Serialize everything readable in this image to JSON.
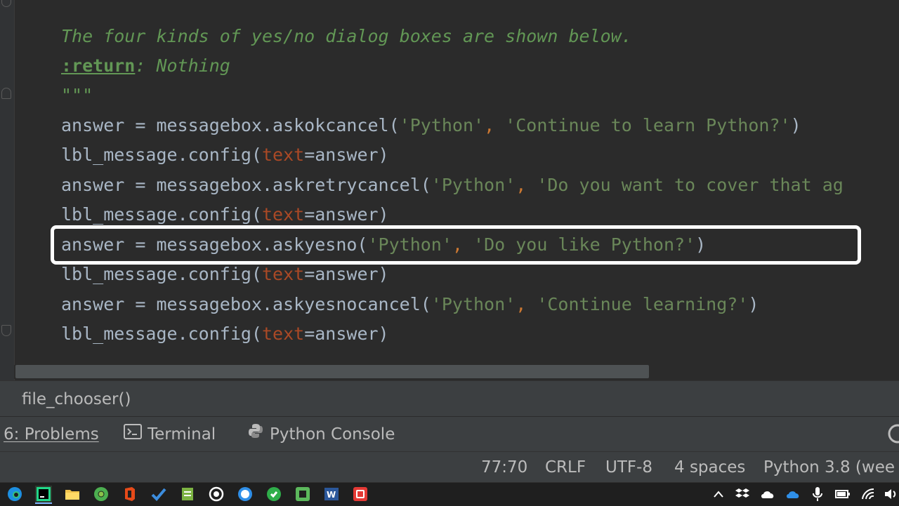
{
  "editor": {
    "lines": [
      {
        "tokens": [
          {
            "t": "\"\"\"",
            "c": "doc"
          }
        ]
      },
      {
        "tokens": [
          {
            "t": "The four kinds of yes/no dialog boxes are shown below.",
            "c": "doc"
          }
        ]
      },
      {
        "tokens": [
          {
            "t": ":return",
            "c": "doctag"
          },
          {
            "t": ": Nothing",
            "c": "doc"
          }
        ]
      },
      {
        "tokens": [
          {
            "t": "\"\"\"",
            "c": "doc"
          }
        ]
      },
      {
        "tokens": [
          {
            "t": "answer = messagebox.askokcancel(",
            "c": ""
          },
          {
            "t": "'Python'",
            "c": "str"
          },
          {
            "t": ", ",
            "c": "kw"
          },
          {
            "t": "'Continue to learn Python?'",
            "c": "str"
          },
          {
            "t": ")",
            "c": ""
          }
        ]
      },
      {
        "tokens": [
          {
            "t": "lbl_message.config(",
            "c": ""
          },
          {
            "t": "text",
            "c": "param"
          },
          {
            "t": "=answer)",
            "c": ""
          }
        ]
      },
      {
        "tokens": [
          {
            "t": "answer = messagebox.askretrycancel(",
            "c": ""
          },
          {
            "t": "'Python'",
            "c": "str"
          },
          {
            "t": ", ",
            "c": "kw"
          },
          {
            "t": "'Do you want to cover that ag",
            "c": "str"
          }
        ]
      },
      {
        "tokens": [
          {
            "t": "lbl_message.config(",
            "c": ""
          },
          {
            "t": "text",
            "c": "param"
          },
          {
            "t": "=answer)",
            "c": ""
          }
        ]
      },
      {
        "tokens": [
          {
            "t": "answer = messagebox.askyesno(",
            "c": ""
          },
          {
            "t": "'Python'",
            "c": "str"
          },
          {
            "t": ", ",
            "c": "kw"
          },
          {
            "t": "'Do you like Python?'",
            "c": "str"
          },
          {
            "t": ")",
            "c": ""
          }
        ]
      },
      {
        "tokens": [
          {
            "t": "lbl_message.config(",
            "c": ""
          },
          {
            "t": "text",
            "c": "param"
          },
          {
            "t": "=answer)",
            "c": ""
          }
        ]
      },
      {
        "tokens": [
          {
            "t": "answer = messagebox.askyesnocancel(",
            "c": ""
          },
          {
            "t": "'Python'",
            "c": "str"
          },
          {
            "t": ", ",
            "c": "kw"
          },
          {
            "t": "'Continue learning?'",
            "c": "str"
          },
          {
            "t": ")",
            "c": ""
          }
        ]
      },
      {
        "tokens": [
          {
            "t": "lbl_message.config(",
            "c": ""
          },
          {
            "t": "text",
            "c": "param"
          },
          {
            "t": "=answer)",
            "c": ""
          }
        ]
      }
    ]
  },
  "breadcrumb": {
    "label": "file_chooser()"
  },
  "tool_tabs": {
    "problems": "6: Problems",
    "terminal": "Terminal",
    "python_console": "Python Console"
  },
  "status_bar": {
    "position": "77:70",
    "line_separator": "CRLF",
    "encoding": "UTF-8",
    "indent": "4 spaces",
    "interpreter": "Python 3.8 (wee"
  },
  "colors": {
    "editor_bg": "#2b2b2b",
    "docstring": "#629755",
    "string": "#6a8759",
    "keyword": "#cc7832",
    "param": "#aa4926",
    "default_text": "#a9b7c6",
    "highlight_border": "#ffffff"
  },
  "taskbar": {
    "apps": [
      "edge-icon",
      "pycharm-icon",
      "file-explorer-icon",
      "chrome-icon",
      "office-icon",
      "todo-icon",
      "notepad-icon",
      "whatsapp-icon",
      "signal-icon",
      "greenshot-icon",
      "camtasia-icon",
      "word-icon",
      "recorder-icon"
    ],
    "tray": [
      "chevron-up-icon",
      "dropbox-icon",
      "cloud-icon",
      "onedrive-icon",
      "microphone-icon",
      "battery-icon",
      "wifi-icon",
      "volume-icon"
    ]
  }
}
